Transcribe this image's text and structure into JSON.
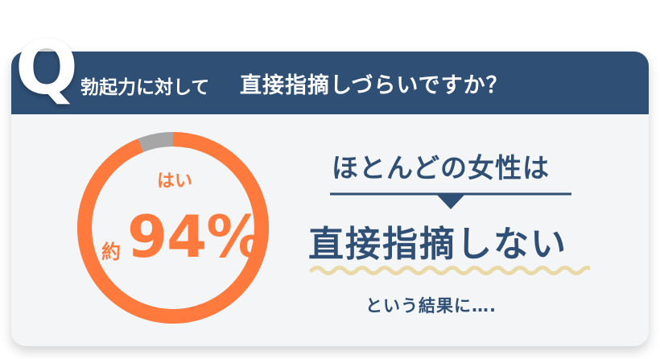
{
  "question": {
    "badge_letter": "Q",
    "lead_text": "勃起力に対して",
    "emphasis_text": "直接指摘しづらいですか？"
  },
  "result": {
    "answer_label": "はい",
    "approx_prefix": "約",
    "percent_text": "94%",
    "percent_value": 94
  },
  "message": {
    "headline_top": "ほとんどの女性は",
    "headline_main": "直接指摘しない",
    "conclusion": "という結果に…."
  },
  "colors": {
    "header_bg": "#2f4f74",
    "accent_orange": "#ff7a3c",
    "remainder_gray": "#a6a6a6",
    "wave_yellow": "#e8d9a6",
    "card_bg": "#f4f5f7"
  }
}
